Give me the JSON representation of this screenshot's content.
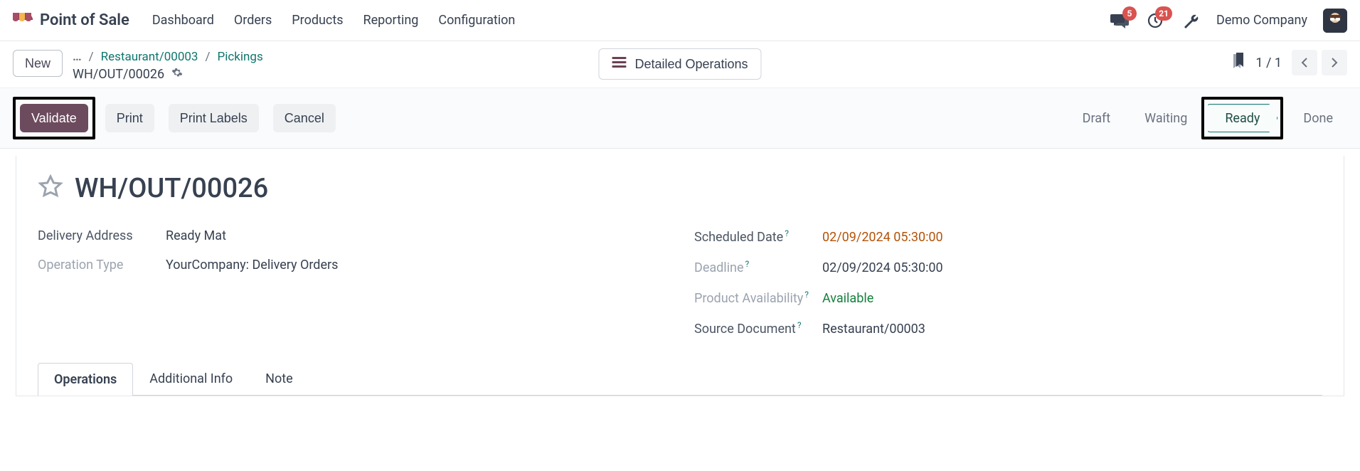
{
  "navbar": {
    "app_title": "Point of Sale",
    "menu": [
      "Dashboard",
      "Orders",
      "Products",
      "Reporting",
      "Configuration"
    ],
    "messages_badge": "5",
    "activities_badge": "21",
    "company": "Demo Company"
  },
  "control_panel": {
    "new_label": "New",
    "breadcrumb_root_icon": "…",
    "breadcrumb_links": [
      "Restaurant/00003",
      "Pickings"
    ],
    "breadcrumb_current": "WH/OUT/00026",
    "detailed_ops_label": "Detailed Operations",
    "pager": "1 / 1"
  },
  "actions": {
    "validate": "Validate",
    "print": "Print",
    "print_labels": "Print Labels",
    "cancel": "Cancel"
  },
  "statusbar": [
    "Draft",
    "Waiting",
    "Ready",
    "Done"
  ],
  "statusbar_current_index": 2,
  "record": {
    "title": "WH/OUT/00026",
    "left_fields": [
      {
        "label": "Delivery Address",
        "value": "Ready Mat",
        "muted": false
      },
      {
        "label": "Operation Type",
        "value": "YourCompany: Delivery Orders",
        "muted": true
      }
    ],
    "right_fields": [
      {
        "label": "Scheduled Date",
        "hint": true,
        "value": "02/09/2024 05:30:00",
        "value_class": "warn"
      },
      {
        "label": "Deadline",
        "hint": true,
        "value": "02/09/2024 05:30:00",
        "muted": true
      },
      {
        "label": "Product Availability",
        "hint": true,
        "value": "Available",
        "value_class": "ok",
        "muted": true
      },
      {
        "label": "Source Document",
        "hint": true,
        "value": "Restaurant/00003"
      }
    ],
    "tabs": [
      "Operations",
      "Additional Info",
      "Note"
    ],
    "active_tab_index": 0
  }
}
